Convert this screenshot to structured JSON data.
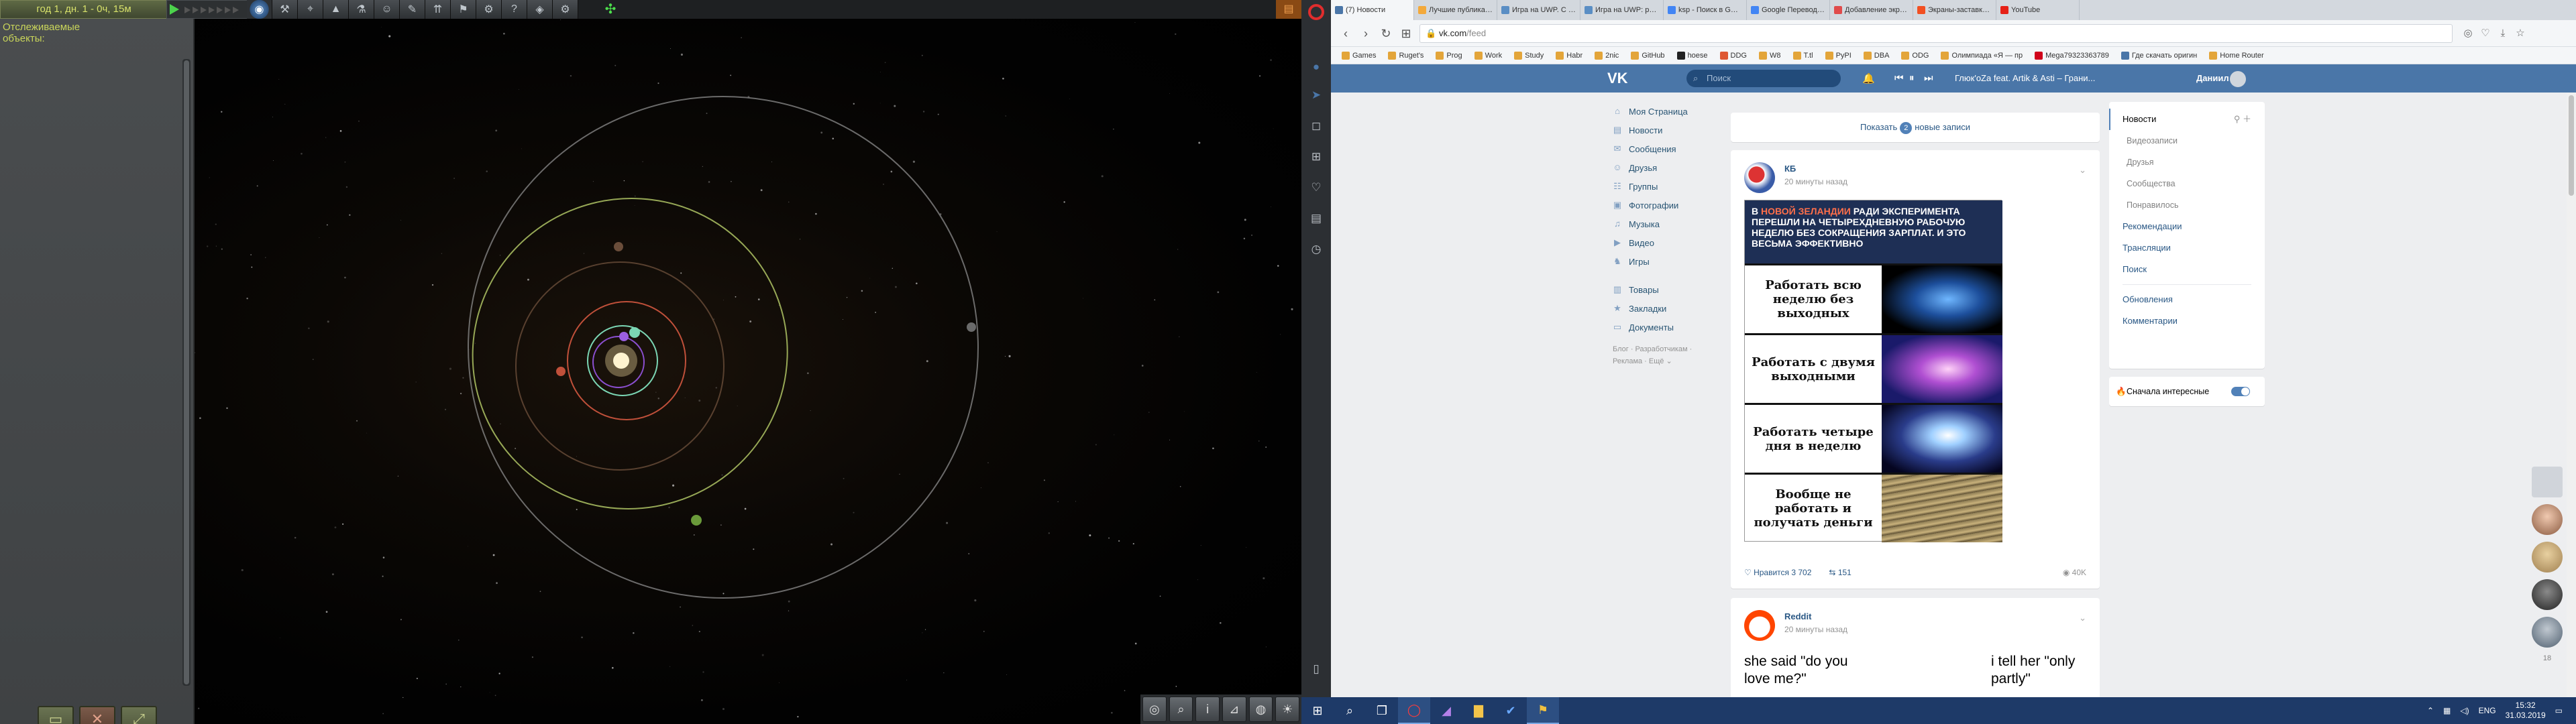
{
  "ksp": {
    "date": "год 1, дн. 1 - 0ч, 15м",
    "tracked_title": "Отслеживаемые объекты:",
    "toolbar_icons": [
      "globe-icon",
      "wrench-icon",
      "antenna-icon",
      "rocket-icon",
      "science-icon",
      "kerbal-icon",
      "contracts-icon",
      "launch-icon",
      "strategy-icon",
      "gear-icon",
      "info-icon",
      "node-icon",
      "engineer-icon"
    ],
    "buttons": [
      "fly-button",
      "delete-button",
      "recover-button"
    ]
  },
  "browser": {
    "tabs": [
      {
        "label": "(7) Новости",
        "color": "#4a76a8"
      },
      {
        "label": "Лучшие публикации за",
        "color": "#f3a93b"
      },
      {
        "label": "Игра на UWP. С чего на",
        "color": "#5a8ec4"
      },
      {
        "label": "Игра на UWP: расширя",
        "color": "#5a8ec4"
      },
      {
        "label": "ksp - Поиск в Google",
        "color": "#4285f4"
      },
      {
        "label": "Google Переводчик",
        "color": "#4285f4"
      },
      {
        "label": "Добавление экрана-за",
        "color": "#e04b4b"
      },
      {
        "label": "Экраны-заставки - UW",
        "color": "#f25022"
      },
      {
        "label": "YouTube",
        "color": "#e62117"
      }
    ],
    "url_host": "vk.com",
    "url_path": "/feed",
    "bookmarks": [
      {
        "label": "Games",
        "color": "#e3a53a"
      },
      {
        "label": "Ruget's",
        "color": "#e3a53a"
      },
      {
        "label": "Prog",
        "color": "#e3a53a"
      },
      {
        "label": "Work",
        "color": "#e3a53a"
      },
      {
        "label": "Study",
        "color": "#e3a53a"
      },
      {
        "label": "Habr",
        "color": "#e3a53a"
      },
      {
        "label": "2nic",
        "color": "#e3a53a"
      },
      {
        "label": "GitHub",
        "color": "#e3a53a"
      },
      {
        "label": "hoese",
        "color": "#222"
      },
      {
        "label": "DDG",
        "color": "#de5833"
      },
      {
        "label": "W8",
        "color": "#e3a53a"
      },
      {
        "label": "T.tl",
        "color": "#e3a53a"
      },
      {
        "label": "PyPI",
        "color": "#e3a53a"
      },
      {
        "label": "DBA",
        "color": "#e3a53a"
      },
      {
        "label": "ODG",
        "color": "#e3a53a"
      },
      {
        "label": "Олимпиада «Я — пр",
        "color": "#e3a53a"
      },
      {
        "label": "Mega79323363789",
        "color": "#d0021b"
      },
      {
        "label": "Где скачать оригин",
        "color": "#4a76a8"
      },
      {
        "label": "Home Router",
        "color": "#e3a53a"
      }
    ]
  },
  "vk": {
    "search_placeholder": "Поиск",
    "now_playing": "Глюк'oZa feat. Artik & Asti – Грани...",
    "user_name": "Даниил",
    "left_menu": [
      {
        "label": "Моя Страница",
        "icon": "home-icon"
      },
      {
        "label": "Новости",
        "icon": "news-icon"
      },
      {
        "label": "Сообщения",
        "icon": "messages-icon"
      },
      {
        "label": "Друзья",
        "icon": "friends-icon"
      },
      {
        "label": "Группы",
        "icon": "groups-icon"
      },
      {
        "label": "Фотографии",
        "icon": "photos-icon"
      },
      {
        "label": "Музыка",
        "icon": "music-icon"
      },
      {
        "label": "Видео",
        "icon": "video-icon"
      },
      {
        "label": "Игры",
        "icon": "games-icon"
      }
    ],
    "left_menu2": [
      {
        "label": "Товары",
        "icon": "market-icon"
      },
      {
        "label": "Закладки",
        "icon": "bookmark-icon"
      },
      {
        "label": "Документы",
        "icon": "docs-icon"
      }
    ],
    "footer_links": "Блог · Разработчикам · Реклама · Ещё ⌄",
    "show_new_pre": "Показать",
    "show_new_count": "2",
    "show_new_post": "новые записи",
    "post1": {
      "author": "КБ",
      "time": "20 минуты назад",
      "headline_pre": "В",
      "headline_hl": "НОВОЙ ЗЕЛАНДИИ",
      "headline_post": "РАДИ ЭКСПЕРИМЕНТА ПЕРЕШЛИ НА ЧЕТЫРЕХДНЕВНУЮ РАБОЧУЮ НЕДЕЛЮ БЕЗ СОКРАЩЕНИЯ ЗАРПЛАТ. И ЭТО ВЕСЬМА ЭФФЕКТИВНО",
      "meme_rows": [
        "Работать всю неделю без выходных",
        "Работать с двумя выходными",
        "Работать четыре дня в неделю",
        "Вообще не работать и получать деньги"
      ],
      "likes": "Нравится 3 702",
      "reposts": "151",
      "views": "40K"
    },
    "post2": {
      "author": "Reddit",
      "time": "20 минуты назад",
      "left_text": "she said \"do you love me?\"",
      "right_text": "i tell her \"only partly\""
    },
    "right_menu": [
      {
        "label": "Новости",
        "type": "active"
      },
      {
        "label": "Видеозаписи",
        "type": "sub"
      },
      {
        "label": "Друзья",
        "type": "sub"
      },
      {
        "label": "Сообщества",
        "type": "sub"
      },
      {
        "label": "Понравилось",
        "type": "sub"
      },
      {
        "label": "Рекомендации",
        "type": "item"
      },
      {
        "label": "Трансляции",
        "type": "item"
      },
      {
        "label": "Поиск",
        "type": "item"
      }
    ],
    "right_menu2": [
      "Обновления",
      "Комментарии"
    ],
    "toggle_label": "Сначала интересные",
    "friends_count": "18"
  },
  "taskbar": {
    "time": "15:32",
    "date": "31.03.2019",
    "lang": "ENG"
  }
}
